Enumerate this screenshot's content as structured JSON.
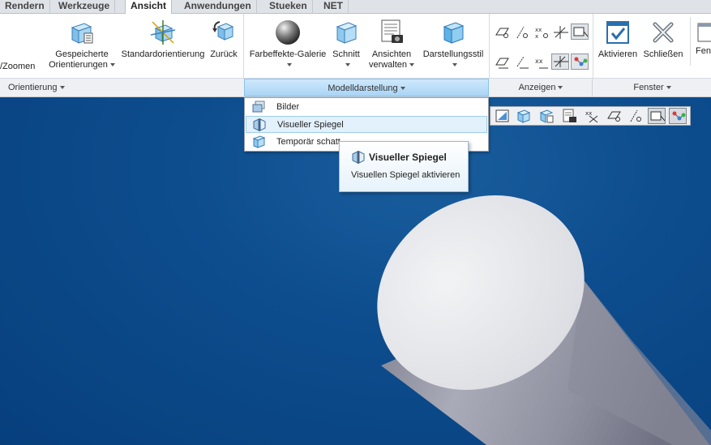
{
  "tabs": [
    {
      "label": "Rendern",
      "active": false
    },
    {
      "label": "Werkzeuge",
      "active": false
    },
    {
      "label": "Ansicht",
      "active": true
    },
    {
      "label": "Anwendungen",
      "active": false
    },
    {
      "label": "Stueken",
      "active": false
    },
    {
      "label": "NET",
      "active": false
    }
  ],
  "ribbon": {
    "zoom_label": "/Zoomen",
    "saved_orientations": [
      "Gespeicherte",
      "Orientierungen"
    ],
    "standard_orientation": "Standardorientierung",
    "back": "Zurück",
    "appearance_gallery": "Farbeffekte-Galerie",
    "section": "Schnitt",
    "manage_views": [
      "Ansichten",
      "verwalten"
    ],
    "display_style": "Darstellungsstil",
    "activate": "Aktivieren",
    "close": "Schließen",
    "window_partial": "Fen"
  },
  "groups": {
    "orientation": "Orientierung",
    "model_display": "Modelldarstellung",
    "show": "Anzeigen",
    "window": "Fenster"
  },
  "dropdown": {
    "items": [
      {
        "label": "Bilder"
      },
      {
        "label": "Visueller Spiegel"
      },
      {
        "label": "Temporär schatt"
      }
    ]
  },
  "tooltip": {
    "title": "Visueller Spiegel",
    "description": "Visuellen Spiegel aktivieren"
  },
  "colors": {
    "viewport_bg": "#0a4a8c",
    "accent": "#a9d5f5",
    "model_surface": "#e4e6ea"
  }
}
